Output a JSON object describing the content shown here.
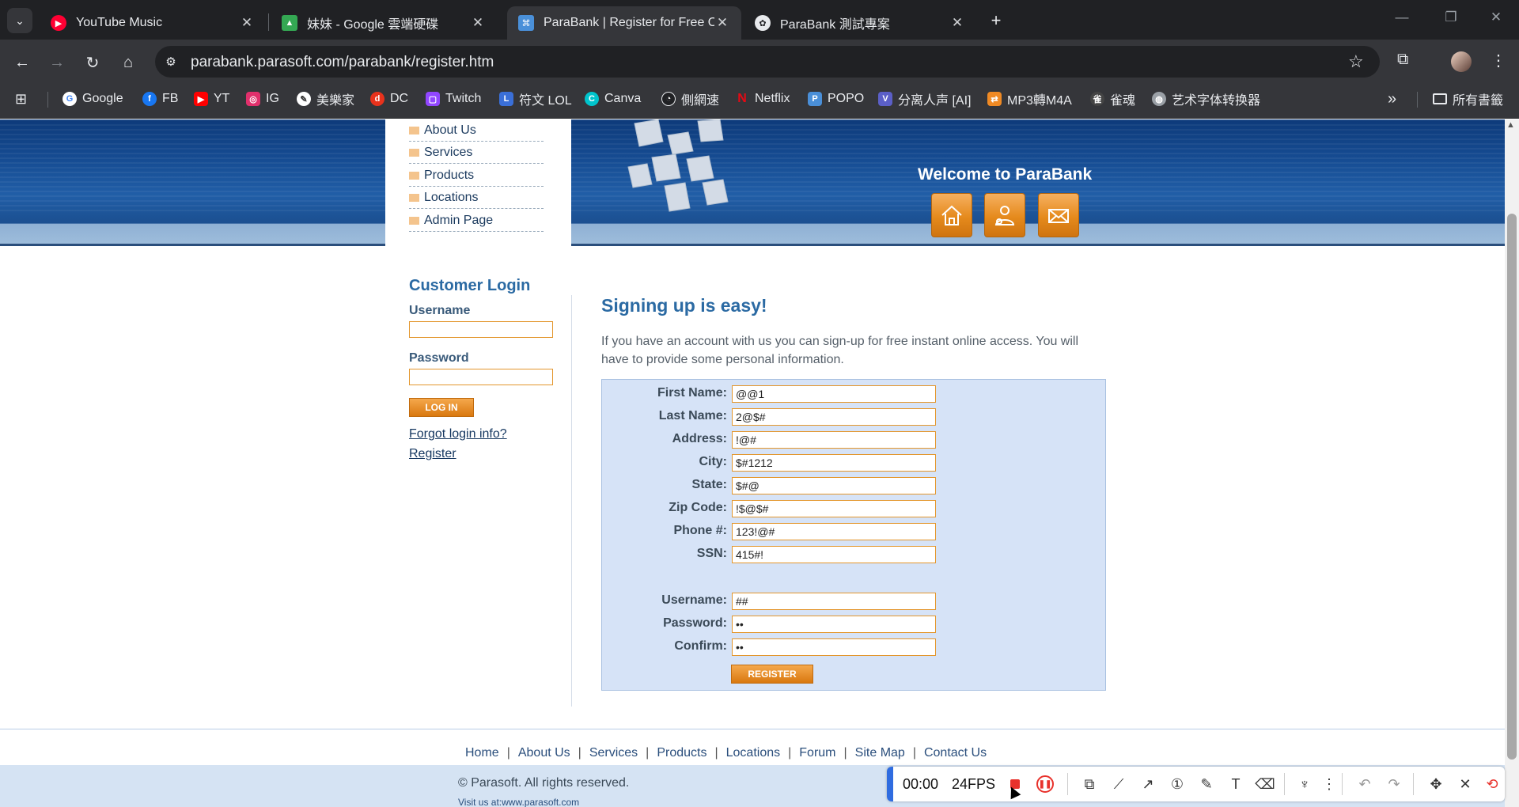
{
  "browser": {
    "tabs": [
      {
        "title": "YouTube Music",
        "icon": "youtube-music-icon",
        "color": "#ff0033"
      },
      {
        "title": "妹妹 - Google 雲端硬碟",
        "icon": "google-drive-icon",
        "color": "#34a853"
      },
      {
        "title": "ParaBank | Register for Free Onl",
        "icon": "parabank-icon",
        "color": "#4a90d9"
      },
      {
        "title": "ParaBank 測試專案",
        "icon": "chatgpt-icon",
        "color": "#e8eaed"
      }
    ],
    "active_tab": 2,
    "url": "parabank.parasoft.com/parabank/register.htm",
    "bookmarks": [
      {
        "label": "Google",
        "color": "#ffffff"
      },
      {
        "label": "FB",
        "color": "#1877f2"
      },
      {
        "label": "YT",
        "color": "#ff0000"
      },
      {
        "label": "IG",
        "color": "#e1306c"
      },
      {
        "label": "美樂家",
        "color": "#ffffff"
      },
      {
        "label": "DC",
        "color": "#e8321c"
      },
      {
        "label": "Twitch",
        "color": "#9146ff"
      },
      {
        "label": "符文 LOL",
        "color": "#3a6fd8"
      },
      {
        "label": "Canva",
        "color": "#00c4cc"
      },
      {
        "label": "側網速",
        "color": "#202124"
      },
      {
        "label": "Netflix",
        "color": "#e50914"
      },
      {
        "label": "POPO",
        "color": "#4a8fd8"
      },
      {
        "label": "分离人声 [AI]",
        "color": "#5b5fc7"
      },
      {
        "label": "MP3轉M4A",
        "color": "#f08a24"
      },
      {
        "label": "雀魂",
        "color": "#444444"
      },
      {
        "label": "艺术字体转换器",
        "color": "#9aa0a6"
      }
    ],
    "all_bookmarks": "所有書籤"
  },
  "header": {
    "menu": [
      "About Us",
      "Services",
      "Products",
      "Locations",
      "Admin Page"
    ],
    "welcome": "Welcome to ParaBank",
    "icons": [
      "home-icon",
      "contact-icon",
      "email-icon"
    ]
  },
  "login": {
    "title": "Customer Login",
    "username_label": "Username",
    "password_label": "Password",
    "button": "LOG IN",
    "forgot": "Forgot login info?",
    "register": "Register"
  },
  "signup": {
    "title": "Signing up is easy!",
    "intro": "If you have an account with us you can sign-up for free instant online access. You will have to provide some personal information.",
    "fields": [
      {
        "label": "First Name:",
        "value": "@@1"
      },
      {
        "label": "Last Name:",
        "value": "2@$#"
      },
      {
        "label": "Address:",
        "value": "!@#"
      },
      {
        "label": "City:",
        "value": "$#1212"
      },
      {
        "label": "State:",
        "value": "$#@"
      },
      {
        "label": "Zip Code:",
        "value": "!$@$#"
      },
      {
        "label": "Phone #:",
        "value": "123!@#"
      },
      {
        "label": "SSN:",
        "value": "415#!"
      }
    ],
    "account": [
      {
        "label": "Username:",
        "value": "##"
      },
      {
        "label": "Password:",
        "value": "••"
      },
      {
        "label": "Confirm:",
        "value": "••"
      }
    ],
    "button": "REGISTER"
  },
  "footer": {
    "links": [
      "Home",
      "About Us",
      "Services",
      "Products",
      "Locations",
      "Forum",
      "Site Map",
      "Contact Us"
    ],
    "copyright": "© Parasoft. All rights reserved.",
    "visit": "Visit us at:www.parasoft.com"
  },
  "recorder": {
    "time": "00:00",
    "fps": "24FPS"
  }
}
